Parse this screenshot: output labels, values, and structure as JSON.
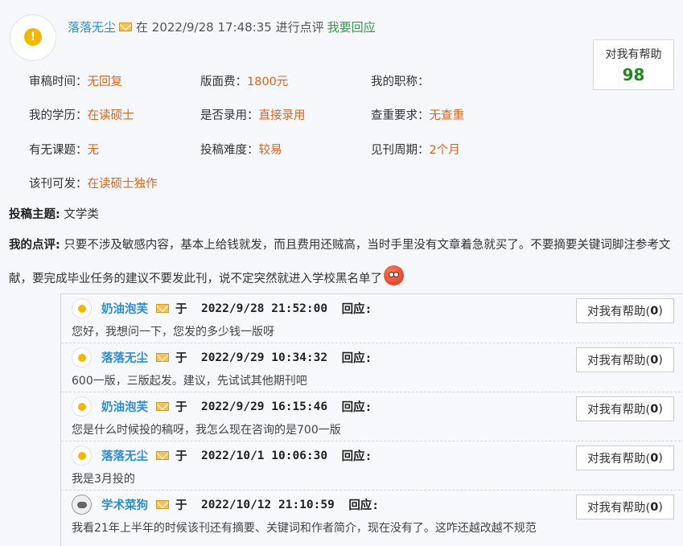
{
  "review": {
    "author": "落落无尘",
    "time_prefix": "在 2022/9/28 17:48:35 进行点评",
    "reply_link": "我要回应",
    "helpful_label": "对我有帮助",
    "helpful_count": "98",
    "fields": [
      {
        "key": "审稿时间：",
        "value": "无回复"
      },
      {
        "key": "版面费：",
        "value": "1800元"
      },
      {
        "key": "我的职称：",
        "value": ""
      },
      {
        "key": "我的学历：",
        "value": "在读硕士"
      },
      {
        "key": "是否录用：",
        "value": "直接录用"
      },
      {
        "key": "查重要求：",
        "value": "无查重"
      },
      {
        "key": "有无课题：",
        "value": "无"
      },
      {
        "key": "投稿难度：",
        "value": "较易"
      },
      {
        "key": "见刊周期：",
        "value": "2个月"
      },
      {
        "key": "该刊可发：",
        "value": "在读硕士独作"
      }
    ],
    "topic_label": "投稿主题:",
    "topic_value": "文学类",
    "comment_label": "我的点评:",
    "comment_text": "只要不涉及敏感内容，基本上给钱就发，而且费用还贼高，当时手里没有文章着急就买了。不要摘要关键词脚注参考文献，要完成毕业任务的建议不要发此刊，说不定突然就进入学校黑名单了"
  },
  "replies": [
    {
      "user": "奶油泡芙",
      "at": "于",
      "time": "2022/9/28 21:52:00",
      "verb": "回应:",
      "text": "您好，我想问一下，您发的多少钱一版呀",
      "help_label": "对我有帮助(",
      "help_count": "0",
      "help_close": ")"
    },
    {
      "user": "落落无尘",
      "at": "于",
      "time": "2022/9/29 10:34:32",
      "verb": "回应:",
      "text": "600一版，三版起发。建议，先试试其他期刊吧",
      "help_label": "对我有帮助(",
      "help_count": "0",
      "help_close": ")"
    },
    {
      "user": "奶油泡芙",
      "at": "于",
      "time": "2022/9/29 16:15:46",
      "verb": "回应:",
      "text": "您是什么时候投的稿呀，我怎么现在咨询的是700一版",
      "help_label": "对我有帮助(",
      "help_count": "0",
      "help_close": ")"
    },
    {
      "user": "落落无尘",
      "at": "于",
      "time": "2022/10/1 10:06:30",
      "verb": "回应:",
      "text": "我是3月投的",
      "help_label": "对我有帮助(",
      "help_count": "0",
      "help_close": ")"
    },
    {
      "user": "学术菜狗",
      "at": "于",
      "time": "2022/10/12 21:10:59",
      "verb": "回应:",
      "text": "我看21年上半年的时候该刊还有摘要、关键词和作者简介，现在没有了。这咋还越改越不规范",
      "help_label": "对我有帮助(",
      "help_count": "0",
      "help_close": ")"
    }
  ]
}
